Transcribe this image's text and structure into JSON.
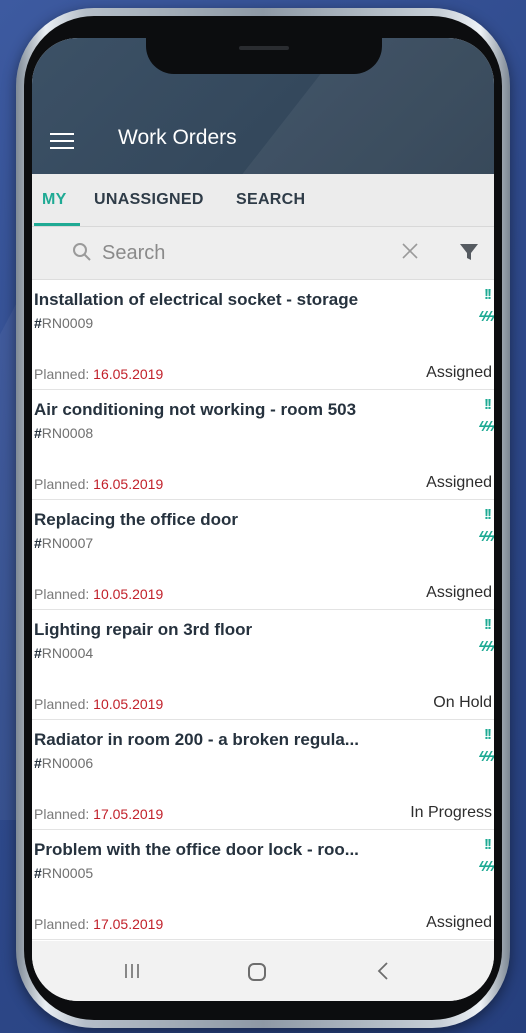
{
  "app": {
    "title": "Work Orders"
  },
  "tabs": [
    "MY",
    "UNASSIGNED",
    "SEARCH"
  ],
  "search": {
    "placeholder": "Search"
  },
  "labels": {
    "planned": "Planned: ",
    "id_prefix": "#",
    "priority_mark": "!!",
    "energy_mark": "ϟϟϟ"
  },
  "colors": {
    "accent": "#1faa94",
    "appbar": "#34485c",
    "date": "#c2202a"
  },
  "work_orders": [
    {
      "title": "Installation of electrical socket - storage",
      "id": "RN0009",
      "planned": "16.05.2019",
      "status": "Assigned"
    },
    {
      "title": "Air conditioning not working - room 503",
      "id": "RN0008",
      "planned": "16.05.2019",
      "status": "Assigned"
    },
    {
      "title": "Replacing the office door",
      "id": "RN0007",
      "planned": "10.05.2019",
      "status": "Assigned"
    },
    {
      "title": "Lighting repair on 3rd floor",
      "id": "RN0004",
      "planned": "10.05.2019",
      "status": "On Hold"
    },
    {
      "title": "Radiator in room 200 - a broken regula...",
      "id": "RN0006",
      "planned": "17.05.2019",
      "status": "In Progress"
    },
    {
      "title": "Problem with the office door lock - roo...",
      "id": "RN0005",
      "planned": "17.05.2019",
      "status": "Assigned"
    }
  ],
  "icons": {
    "menu": "menu-icon",
    "search": "search-icon",
    "clear": "close-icon",
    "filter": "filter-icon",
    "nav_recent": "recent-apps-icon",
    "nav_home": "home-icon",
    "nav_back": "back-icon"
  }
}
